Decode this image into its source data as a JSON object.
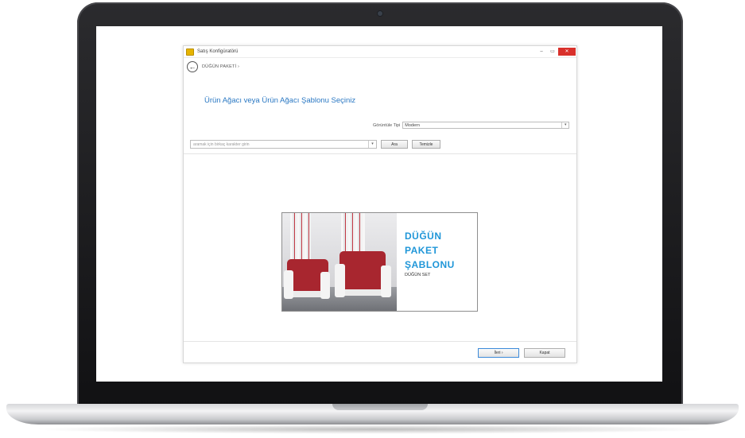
{
  "window": {
    "title": "Satış Konfigüratörü",
    "minimize_glyph": "–",
    "maximize_glyph": "▭",
    "close_glyph": "✕"
  },
  "nav": {
    "back_glyph": "←",
    "breadcrumb": "DÜĞÜN PAKETİ  ›"
  },
  "page": {
    "heading": "Ürün Ağacı veya Ürün Ağacı Şablonu Seçiniz"
  },
  "filters": {
    "type_label": "Görüntüle Tipi",
    "type_value": "Modern",
    "search_placeholder": "aramak için birkaç karakter girin",
    "search_button": "Ara",
    "clear_button": "Temizle"
  },
  "template_card": {
    "line1": "DÜĞÜN",
    "line2": "PAKET",
    "line3": "ŞABLONU",
    "subtitle": "DÜĞÜN SET"
  },
  "footer": {
    "next_button": "İleri  ›",
    "cancel_button": "Kapat"
  },
  "icons": {
    "dropdown": "▾"
  },
  "colors": {
    "accent": "#2a78c3",
    "brand": "#1f96d8",
    "close": "#d9302b",
    "upholstery": "#a8262f"
  }
}
